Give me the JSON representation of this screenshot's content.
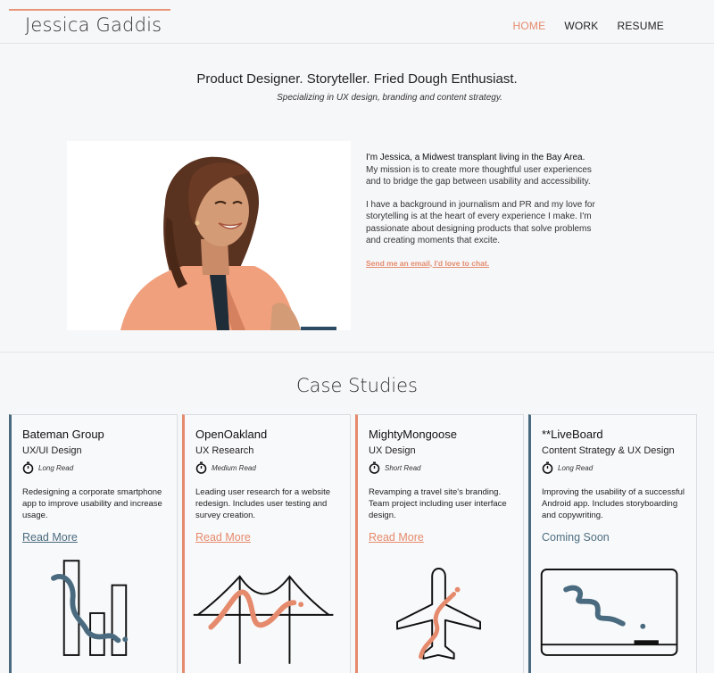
{
  "header": {
    "site_title": "Jessica Gaddis",
    "nav": [
      {
        "label": "HOME",
        "active": true
      },
      {
        "label": "WORK",
        "active": false
      },
      {
        "label": "RESUME",
        "active": false
      }
    ]
  },
  "hero": {
    "tagline": "Product Designer. Storyteller. Fried Dough Enthusiast.",
    "subtagline": "Specializing in UX design, branding and content strategy."
  },
  "intro": {
    "lead": "I'm Jessica, a Midwest transplant living in the Bay Area.",
    "p1_rest": " My mission is to create more thoughtful user experiences and to bridge the gap between usability and accessibility.",
    "p2": "I have a background in journalism and PR and my love for storytelling is at the heart of every experience I make. I'm passionate about designing products that solve problems and creating moments that excite.",
    "email_link": "Send me an email, I'd love to chat."
  },
  "case_studies": {
    "title": "Case Studies",
    "cards": [
      {
        "title": "Bateman Group",
        "role": "UX/UI Design",
        "read": "Long Read",
        "desc": "Redesigning a corporate smartphone app to improve usability and increase usage.",
        "link": "Read More",
        "accent": "#4a6b7f",
        "art": "bar-chart-illustration"
      },
      {
        "title": "OpenOakland",
        "role": "UX Research",
        "read": "Medium Read",
        "desc": "Leading user research for a website redesign. Includes user testing and survey creation.",
        "link": "Read More",
        "accent": "#e58a6c",
        "art": "bridge-illustration"
      },
      {
        "title": "MightyMongoose",
        "role": "UX Design",
        "read": "Short Read",
        "desc": "Revamping a travel site's branding. Team project including user interface design.",
        "link": "Read More",
        "accent": "#e58a6c",
        "art": "airplane-illustration"
      },
      {
        "title": "**LiveBoard",
        "role": "Content Strategy & UX Design",
        "read": "Long Read",
        "desc": "Improving the usability of a successful Android app. Includes storyboarding and copywriting.",
        "link": "Coming Soon",
        "accent": "#4a6b7f",
        "art": "laptop-illustration"
      }
    ]
  },
  "colors": {
    "accent_orange": "#e58a6c",
    "accent_slate": "#4a6b7f",
    "background": "#f6f7f9"
  }
}
